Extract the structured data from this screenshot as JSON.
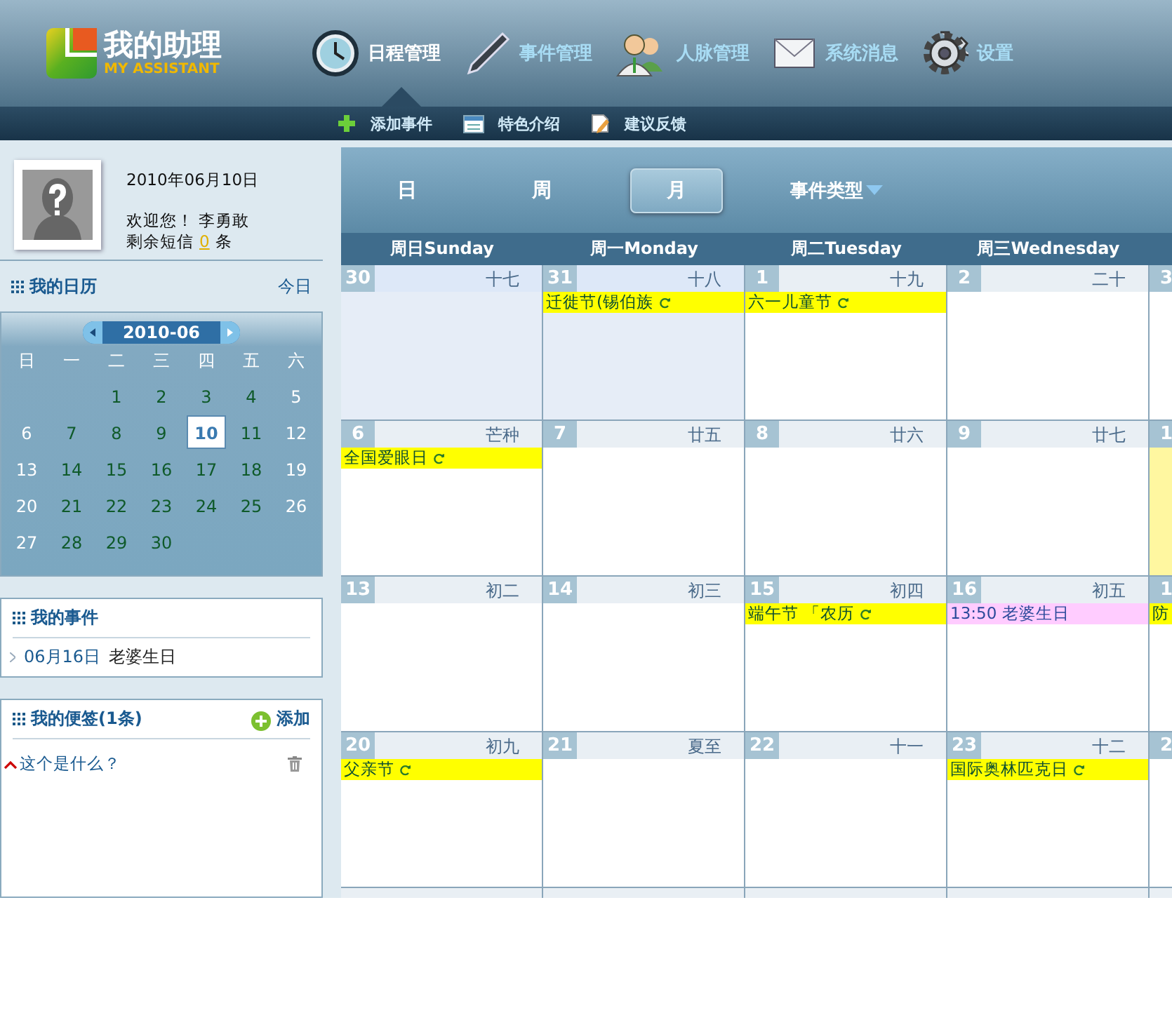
{
  "header": {
    "logo_title": "我的助理",
    "logo_subtitle": "MY ASSISTANT",
    "nav": [
      {
        "label": "日程管理",
        "kind": "clock",
        "selected": true
      },
      {
        "label": "事件管理",
        "kind": "pen",
        "selected": false
      },
      {
        "label": "人脉管理",
        "kind": "people",
        "selected": false
      },
      {
        "label": "系统消息",
        "kind": "mail",
        "selected": false
      },
      {
        "label": "设置",
        "kind": "gear",
        "selected": false
      }
    ],
    "subnav": [
      {
        "label": "添加事件",
        "kind": "add"
      },
      {
        "label": "特色介绍",
        "kind": "list"
      },
      {
        "label": "建议反馈",
        "kind": "edit"
      }
    ]
  },
  "profile": {
    "date": "2010年06月10日",
    "welcome": "欢迎您！ 李勇敢",
    "sms_prefix": "剩余短信",
    "sms_count": "0",
    "sms_suffix": "条"
  },
  "my_calendar": {
    "title": "我的日历",
    "today_link": "今日",
    "month": "2010-06",
    "weekdays": [
      "日",
      "一",
      "二",
      "三",
      "四",
      "五",
      "六"
    ],
    "weeks": [
      {
        "days": [
          {
            "kind": "empty"
          },
          {
            "kind": "empty"
          },
          {
            "kind": "day",
            "day": "1",
            "selected": false
          },
          {
            "day": "2",
            "selected": false
          },
          {
            "day": "3",
            "selected": false
          },
          {
            "day": "4",
            "selected": false
          },
          {
            "day": "5",
            "selected": false
          }
        ]
      },
      {
        "days": [
          {
            "day": "6",
            "selected": false
          },
          {
            "day": "7",
            "selected": false
          },
          {
            "day": "8",
            "selected": false
          },
          {
            "day": "9",
            "selected": false
          },
          {
            "day": "10",
            "selected": true
          },
          {
            "day": "11",
            "selected": false
          },
          {
            "day": "12",
            "selected": false
          }
        ]
      },
      {
        "days": [
          {
            "day": "13",
            "selected": false
          },
          {
            "day": "14",
            "selected": false
          },
          {
            "day": "15",
            "selected": false
          },
          {
            "day": "16",
            "selected": false
          },
          {
            "day": "17",
            "selected": false
          },
          {
            "day": "18",
            "selected": false
          },
          {
            "day": "19",
            "selected": false
          }
        ]
      },
      {
        "days": [
          {
            "day": "20",
            "selected": false
          },
          {
            "day": "21",
            "selected": false
          },
          {
            "day": "22",
            "selected": false
          },
          {
            "day": "23",
            "selected": false
          },
          {
            "day": "24",
            "selected": false
          },
          {
            "day": "25",
            "selected": false
          },
          {
            "day": "26",
            "selected": false
          }
        ]
      },
      {
        "days": [
          {
            "day": "27",
            "selected": false
          },
          {
            "day": "28",
            "selected": false
          },
          {
            "day": "29",
            "selected": false
          },
          {
            "day": "30",
            "selected": false
          }
        ]
      }
    ]
  },
  "my_events": {
    "title": "我的事件",
    "items": [
      {
        "date": "06月16日",
        "title": "老婆生日"
      }
    ]
  },
  "notes": {
    "title": "我的便签(1条)",
    "add_label": "添加",
    "items": [
      {
        "text": "这个是什么？"
      }
    ]
  },
  "calendar": {
    "view_tabs": [
      {
        "label": "日",
        "selected": false
      },
      {
        "label": "周",
        "selected": false
      },
      {
        "label": "月",
        "selected": true
      }
    ],
    "event_type": "事件类型",
    "weekday_headers": [
      "周日Sunday",
      "周一Monday",
      "周二Tuesday",
      "周三Wednesday"
    ],
    "weeks": [
      {
        "cells": [
          {
            "day": "30",
            "lunar": "十七",
            "other_month": true,
            "today": false
          },
          {
            "day": "31",
            "lunar": "十八",
            "other_month": true,
            "today": false,
            "events": [
              {
                "text": "迁徙节(锡伯族",
                "color": "#ffff00",
                "repeat": true
              }
            ]
          },
          {
            "day": "1",
            "lunar": "十九",
            "other_month": false,
            "today": false,
            "events": [
              {
                "text": "六一儿童节",
                "color": "#ffff00",
                "repeat": true
              }
            ]
          },
          {
            "day": "2",
            "lunar": "二十",
            "other_month": false,
            "today": false
          },
          {
            "day": "3",
            "other_month": false,
            "today": false
          }
        ]
      },
      {
        "cells": [
          {
            "day": "6",
            "lunar": "芒种",
            "other_month": false,
            "today": false,
            "events": [
              {
                "text": "全国爱眼日",
                "color": "#ffff00",
                "repeat": true
              }
            ]
          },
          {
            "day": "7",
            "lunar": "廿五",
            "other_month": false,
            "today": false
          },
          {
            "day": "8",
            "lunar": "廿六",
            "other_month": false,
            "today": false
          },
          {
            "day": "9",
            "lunar": "廿七",
            "other_month": false,
            "today": false
          },
          {
            "day": "1",
            "other_month": false,
            "today": true
          }
        ]
      },
      {
        "cells": [
          {
            "day": "13",
            "lunar": "初二",
            "other_month": false,
            "today": false
          },
          {
            "day": "14",
            "lunar": "初三",
            "other_month": false,
            "today": false
          },
          {
            "day": "15",
            "lunar": "初四",
            "other_month": false,
            "today": false,
            "events": [
              {
                "text": "端午节 「农历",
                "color": "#ffff00",
                "repeat": true
              }
            ]
          },
          {
            "day": "16",
            "lunar": "初五",
            "other_month": false,
            "today": false,
            "events": [
              {
                "text": "13:50 老婆生日",
                "color": "#ffccff",
                "repeat": false
              }
            ]
          },
          {
            "day": "1",
            "other_month": false,
            "today": false,
            "events": [
              {
                "text": "防",
                "color": "#ffff00"
              }
            ]
          }
        ]
      },
      {
        "cells": [
          {
            "day": "20",
            "lunar": "初九",
            "other_month": false,
            "today": false,
            "events": [
              {
                "text": "父亲节",
                "color": "#ffff00",
                "repeat": true
              }
            ]
          },
          {
            "day": "21",
            "lunar": "夏至",
            "other_month": false,
            "today": false
          },
          {
            "day": "22",
            "lunar": "十一",
            "other_month": false,
            "today": false
          },
          {
            "day": "23",
            "lunar": "十二",
            "other_month": false,
            "today": false,
            "events": [
              {
                "text": "国际奥林匹克日",
                "color": "#ffff00",
                "repeat": true
              }
            ]
          },
          {
            "day": "2",
            "other_month": false,
            "today": false
          }
        ]
      }
    ]
  }
}
